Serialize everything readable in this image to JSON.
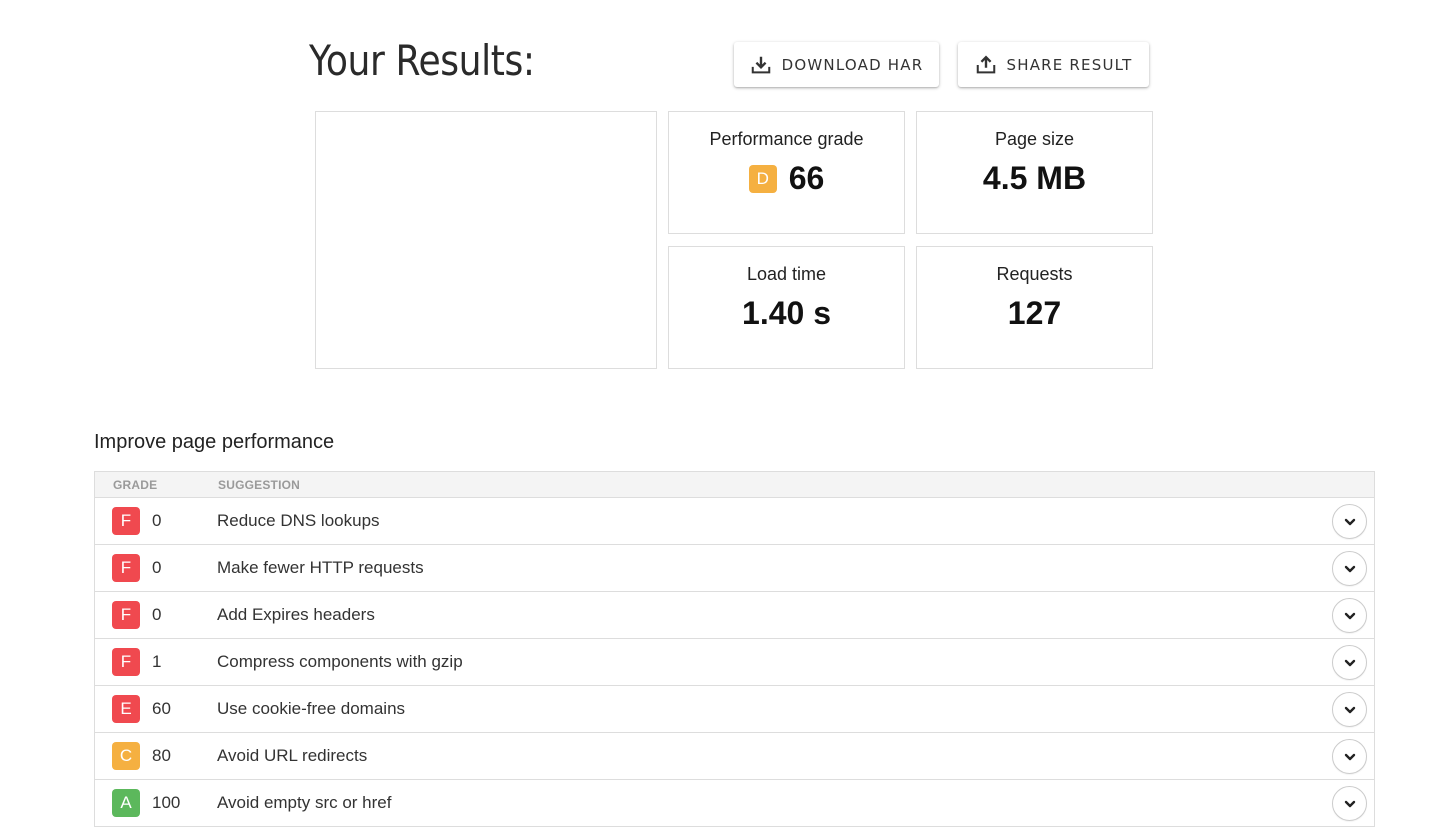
{
  "header": {
    "title": "Your Results:",
    "download_label": "DOWNLOAD HAR",
    "share_label": "SHARE RESULT"
  },
  "stats": {
    "performance": {
      "label": "Performance grade",
      "grade": "D",
      "grade_color": "#f5b041",
      "value": "66"
    },
    "page_size": {
      "label": "Page size",
      "value": "4.5 MB"
    },
    "load_time": {
      "label": "Load time",
      "value": "1.40 s"
    },
    "requests": {
      "label": "Requests",
      "value": "127"
    }
  },
  "improve": {
    "title": "Improve page performance",
    "columns": {
      "grade": "GRADE",
      "suggestion": "SUGGESTION"
    },
    "rows": [
      {
        "grade": "F",
        "color": "#f0494f",
        "score": "0",
        "text": "Reduce DNS lookups"
      },
      {
        "grade": "F",
        "color": "#f0494f",
        "score": "0",
        "text": "Make fewer HTTP requests"
      },
      {
        "grade": "F",
        "color": "#f0494f",
        "score": "0",
        "text": "Add Expires headers"
      },
      {
        "grade": "F",
        "color": "#f0494f",
        "score": "1",
        "text": "Compress components with gzip"
      },
      {
        "grade": "E",
        "color": "#f0494f",
        "score": "60",
        "text": "Use cookie-free domains"
      },
      {
        "grade": "C",
        "color": "#f5b041",
        "score": "80",
        "text": "Avoid URL redirects"
      },
      {
        "grade": "A",
        "color": "#5cb85c",
        "score": "100",
        "text": "Avoid empty src or href"
      }
    ]
  },
  "icons": {
    "download": "download-icon",
    "share": "share-icon",
    "expand": "chevron-down-icon"
  }
}
